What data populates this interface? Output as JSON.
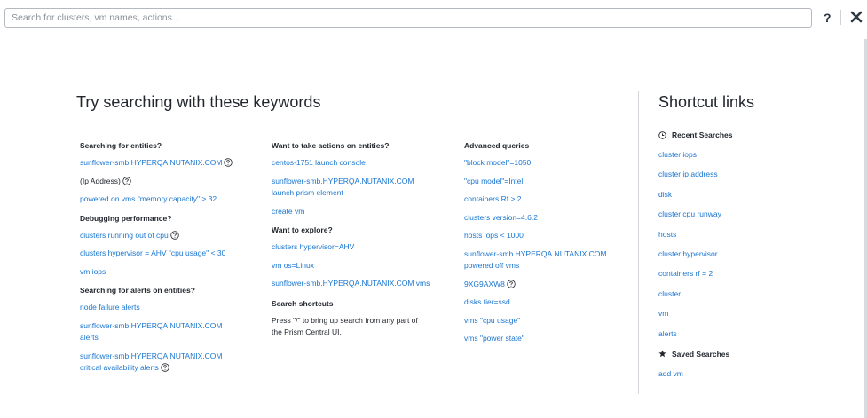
{
  "search": {
    "placeholder": "Search for clusters, vm names, actions..."
  },
  "header": {
    "help_label": "?"
  },
  "keywords": {
    "heading": "Try searching with these keywords",
    "col1": {
      "entities_title": "Searching for entities?",
      "entities_link1": "sunflower-smb.HYPERQA.NUTANIX.COM",
      "entities_text2": "(Ip Address)",
      "entities_link3": "powered on vms \"memory capacity\" > 32",
      "debug_title": "Debugging performance?",
      "debug_link1": "clusters running out of cpu",
      "debug_link2": "clusters hypervisor = AHV \"cpu usage\" < 30",
      "debug_link3": "vm iops",
      "alerts_title": "Searching for alerts on entities?",
      "alerts_link1": "node failure alerts",
      "alerts_link2_line1": "sunflower-smb.HYPERQA.NUTANIX.COM",
      "alerts_link2_line2": "alerts",
      "alerts_link3_line1": "sunflower-smb.HYPERQA.NUTANIX.COM",
      "alerts_link3_line2": "critical availability alerts"
    },
    "col2": {
      "actions_title": "Want to take actions on entities?",
      "actions_link1": "centos-1751 launch console",
      "actions_link2_line1": "sunflower-smb.HYPERQA.NUTANIX.COM",
      "actions_link2_line2": "launch prism element",
      "actions_link3": "create vm",
      "explore_title": "Want to explore?",
      "explore_link1": "clusters hypervisor=AHV",
      "explore_link2": "vm os=Linux",
      "explore_link3": "sunflower-smb.HYPERQA.NUTANIX.COM vms",
      "shortcuts_title": "Search shortcuts",
      "shortcuts_text_line1": "Press \"/\" to bring up search from any part of",
      "shortcuts_text_line2": "the Prism Central UI."
    },
    "col3": {
      "advanced_title": "Advanced queries",
      "links": [
        "\"block model\"=1050",
        "\"cpu model\"=Intel",
        "containers Rf > 2",
        "clusters version=4.6.2",
        "hosts iops < 1000"
      ],
      "powered_line1": "sunflower-smb.HYPERQA.NUTANIX.COM",
      "powered_line2": "powered off vms",
      "serial": "9XG9AXW8",
      "links_after": [
        "disks tier=ssd",
        "vms \"cpu usage\"",
        "vms \"power state\""
      ]
    }
  },
  "shortcuts": {
    "heading": "Shortcut links",
    "recent_title": "Recent Searches",
    "recent": [
      "cluster iops",
      "cluster ip address",
      "disk",
      "cluster cpu runway",
      "hosts",
      "cluster hypervisor",
      "containers rf = 2",
      "cluster",
      "vm",
      "alerts"
    ],
    "saved_title": "Saved Searches",
    "saved": [
      "add vm"
    ]
  },
  "colors": {
    "link": "#1a76d0",
    "text": "#22272e",
    "divider": "#d3d7dc"
  },
  "icons": {
    "help": "question-circle-icon",
    "close": "close-icon",
    "recent": "clock-icon",
    "saved": "star-icon"
  }
}
